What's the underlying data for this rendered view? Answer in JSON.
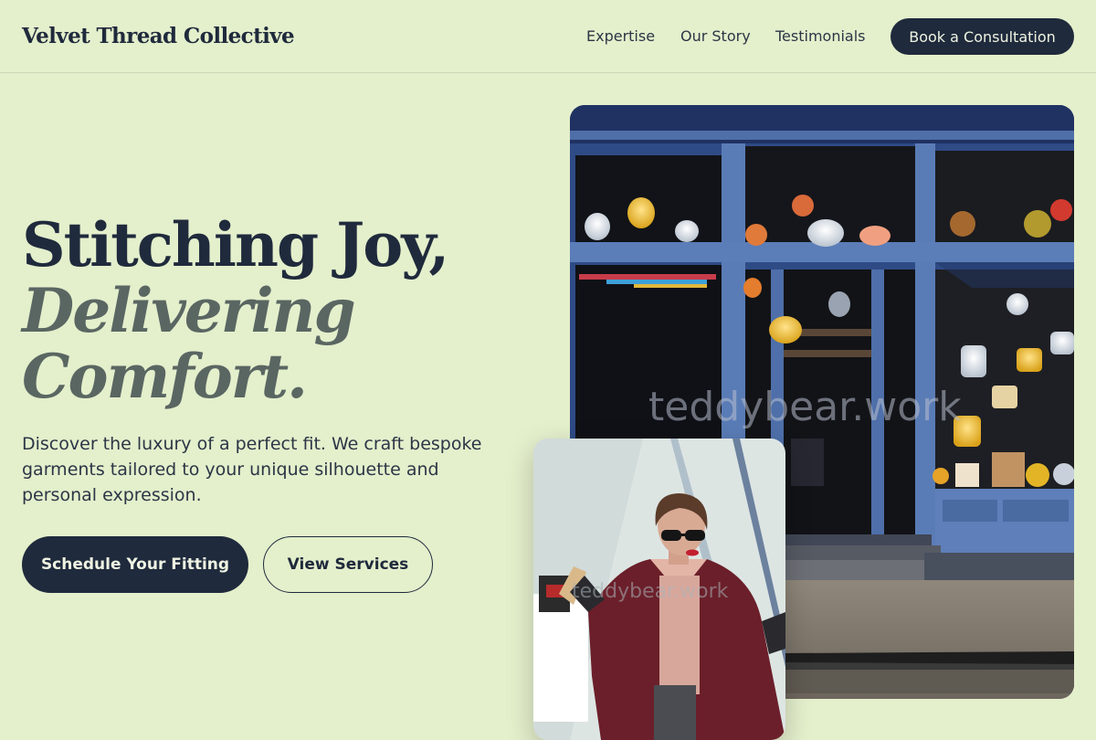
{
  "brand": {
    "name": "Velvet Thread Collective"
  },
  "nav": {
    "links": [
      "Expertise",
      "Our Story",
      "Testimonials"
    ],
    "cta": "Book a Consultation"
  },
  "hero": {
    "headline_line1": "Stitching Joy,",
    "headline_line2": "Delivering",
    "headline_line3": "Comfort.",
    "subtext": "Discover the luxury of a perfect fit. We craft bespoke garments tailored to your unique silhouette and personal expression.",
    "primary_button": "Schedule Your Fitting",
    "secondary_button": "View Services"
  },
  "images": {
    "storefront_alt": "Boutique storefront with hanging lamps",
    "portrait_alt": "Woman in burgundy coat holding shopping bags",
    "watermark": "teddybear.work"
  },
  "colors": {
    "background": "#e4efcc",
    "navy": "#1f2a3c",
    "italic_gray": "#5a6662"
  }
}
